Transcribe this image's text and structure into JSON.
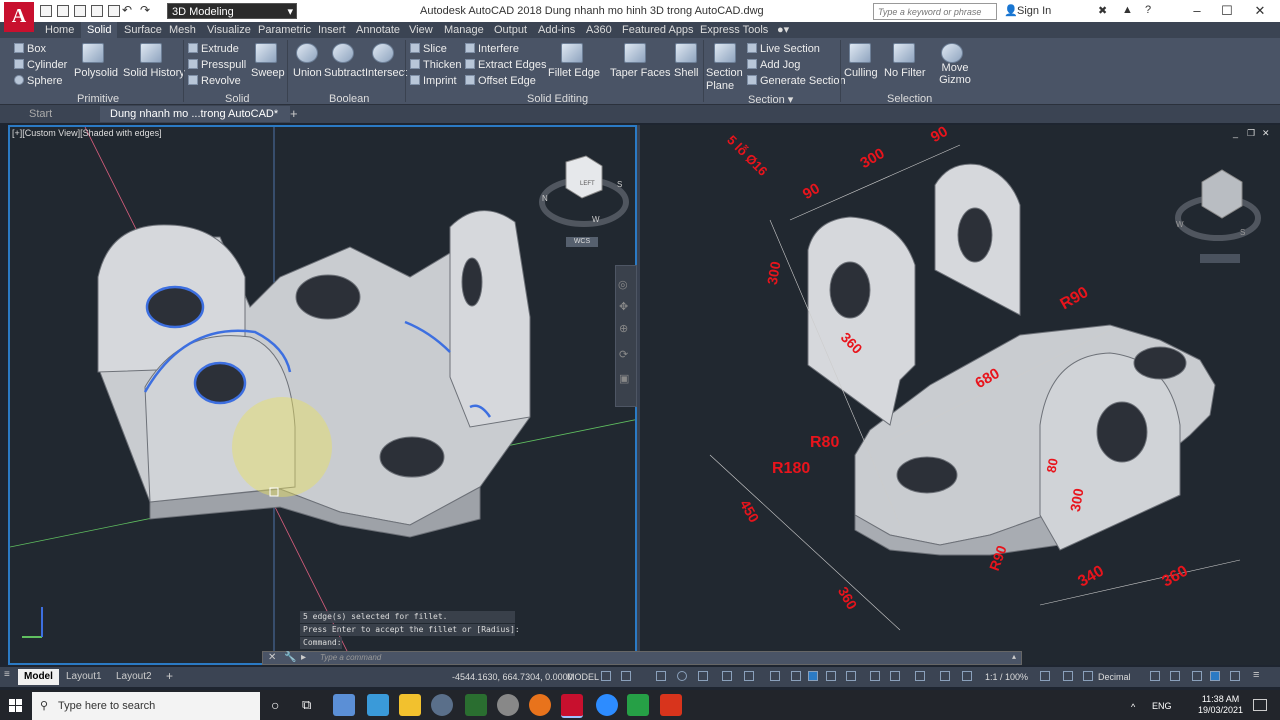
{
  "app": {
    "logo_letter": "A",
    "workspace": "3D Modeling",
    "window_title": "Autodesk AutoCAD 2018     Dung nhanh mo hinh 3D trong AutoCAD.dwg",
    "search_placeholder": "Type a keyword or phrase",
    "signin_label": "Sign In"
  },
  "ribbon_tabs": [
    "Home",
    "Solid",
    "Surface",
    "Mesh",
    "Visualize",
    "Parametric",
    "Insert",
    "Annotate",
    "View",
    "Manage",
    "Output",
    "Add-ins",
    "A360",
    "Featured Apps",
    "Express Tools"
  ],
  "ribbon": {
    "primitive": {
      "box": "Box",
      "cylinder": "Cylinder",
      "sphere": "Sphere",
      "polysolid": "Polysolid",
      "solid_history": "Solid History",
      "label": "Primitive"
    },
    "solid": {
      "extrude": "Extrude",
      "presspull": "Presspull",
      "revolve": "Revolve",
      "sweep": "Sweep",
      "label": "Solid"
    },
    "boolean": {
      "union": "Union",
      "subtract": "Subtract",
      "intersect": "Intersect",
      "label": "Boolean"
    },
    "solid_editing": {
      "slice": "Slice",
      "thicken": "Thicken",
      "imprint": "Imprint",
      "interfere": "Interfere",
      "extract_edges": "Extract Edges",
      "offset_edge": "Offset Edge",
      "fillet_edge": "Fillet Edge",
      "taper_faces": "Taper Faces",
      "shell": "Shell",
      "label": "Solid Editing"
    },
    "section": {
      "section_plane": "Section Plane",
      "live_section": "Live Section",
      "add_jog": "Add Jog",
      "generate_section": "Generate Section",
      "label": "Section"
    },
    "selection": {
      "culling": "Culling",
      "no_filter": "No Filter",
      "move_gizmo": "Move Gizmo",
      "label": "Selection"
    }
  },
  "file_tabs": [
    "Start",
    "Dung nhanh mo ...trong AutoCAD*"
  ],
  "viewport_left": {
    "label": "[+][Custom View][Shaded with edges]",
    "viewcube_face": "LEFT",
    "wcs": "WCS",
    "compass": [
      "N",
      "S",
      "W"
    ]
  },
  "viewport_right": {
    "compass": [
      "W",
      "S"
    ],
    "dimensions": [
      "90",
      "300",
      "90",
      "5 lỗ Ø16",
      "300",
      "360",
      "R90",
      "680",
      "R80",
      "R180",
      "450",
      "80",
      "300",
      "R90",
      "340",
      "360",
      "360"
    ]
  },
  "command": {
    "history": [
      "5 edge(s) selected for fillet.",
      "Press Enter to accept the fillet or [Radius]:",
      "Command:"
    ],
    "placeholder": "Type a command"
  },
  "layout_tabs": [
    "Model",
    "Layout1",
    "Layout2"
  ],
  "status": {
    "coords": "-4544.1630, 664.7304, 0.0000",
    "model": "MODEL",
    "scale": "1:1 / 100%",
    "units": "Decimal"
  },
  "taskbar": {
    "search_placeholder": "Type here to search",
    "lang": "ENG",
    "time": "11:38 AM",
    "date": "19/03/2021"
  },
  "colors": {
    "accent": "#2b7ac4",
    "dimension": "#e8141c",
    "model": "#c9ccd0"
  }
}
